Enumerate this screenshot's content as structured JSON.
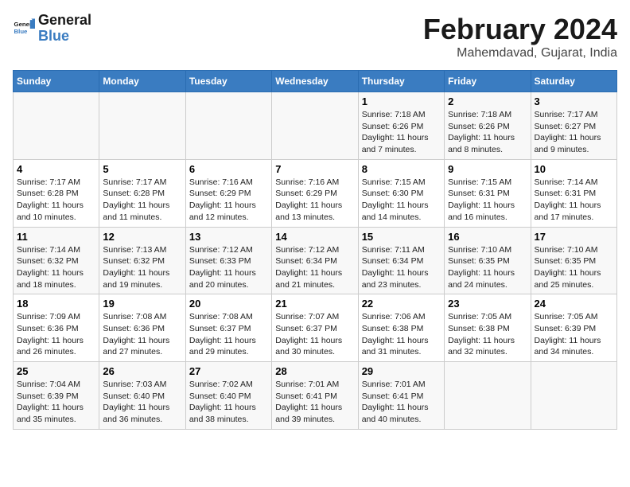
{
  "logo": {
    "line1": "General",
    "line2": "Blue"
  },
  "title": "February 2024",
  "subtitle": "Mahemdavad, Gujarat, India",
  "days_header": [
    "Sunday",
    "Monday",
    "Tuesday",
    "Wednesday",
    "Thursday",
    "Friday",
    "Saturday"
  ],
  "weeks": [
    [
      {
        "day": "",
        "info": ""
      },
      {
        "day": "",
        "info": ""
      },
      {
        "day": "",
        "info": ""
      },
      {
        "day": "",
        "info": ""
      },
      {
        "day": "1",
        "info": "Sunrise: 7:18 AM\nSunset: 6:26 PM\nDaylight: 11 hours and 7 minutes."
      },
      {
        "day": "2",
        "info": "Sunrise: 7:18 AM\nSunset: 6:26 PM\nDaylight: 11 hours and 8 minutes."
      },
      {
        "day": "3",
        "info": "Sunrise: 7:17 AM\nSunset: 6:27 PM\nDaylight: 11 hours and 9 minutes."
      }
    ],
    [
      {
        "day": "4",
        "info": "Sunrise: 7:17 AM\nSunset: 6:28 PM\nDaylight: 11 hours and 10 minutes."
      },
      {
        "day": "5",
        "info": "Sunrise: 7:17 AM\nSunset: 6:28 PM\nDaylight: 11 hours and 11 minutes."
      },
      {
        "day": "6",
        "info": "Sunrise: 7:16 AM\nSunset: 6:29 PM\nDaylight: 11 hours and 12 minutes."
      },
      {
        "day": "7",
        "info": "Sunrise: 7:16 AM\nSunset: 6:29 PM\nDaylight: 11 hours and 13 minutes."
      },
      {
        "day": "8",
        "info": "Sunrise: 7:15 AM\nSunset: 6:30 PM\nDaylight: 11 hours and 14 minutes."
      },
      {
        "day": "9",
        "info": "Sunrise: 7:15 AM\nSunset: 6:31 PM\nDaylight: 11 hours and 16 minutes."
      },
      {
        "day": "10",
        "info": "Sunrise: 7:14 AM\nSunset: 6:31 PM\nDaylight: 11 hours and 17 minutes."
      }
    ],
    [
      {
        "day": "11",
        "info": "Sunrise: 7:14 AM\nSunset: 6:32 PM\nDaylight: 11 hours and 18 minutes."
      },
      {
        "day": "12",
        "info": "Sunrise: 7:13 AM\nSunset: 6:32 PM\nDaylight: 11 hours and 19 minutes."
      },
      {
        "day": "13",
        "info": "Sunrise: 7:12 AM\nSunset: 6:33 PM\nDaylight: 11 hours and 20 minutes."
      },
      {
        "day": "14",
        "info": "Sunrise: 7:12 AM\nSunset: 6:34 PM\nDaylight: 11 hours and 21 minutes."
      },
      {
        "day": "15",
        "info": "Sunrise: 7:11 AM\nSunset: 6:34 PM\nDaylight: 11 hours and 23 minutes."
      },
      {
        "day": "16",
        "info": "Sunrise: 7:10 AM\nSunset: 6:35 PM\nDaylight: 11 hours and 24 minutes."
      },
      {
        "day": "17",
        "info": "Sunrise: 7:10 AM\nSunset: 6:35 PM\nDaylight: 11 hours and 25 minutes."
      }
    ],
    [
      {
        "day": "18",
        "info": "Sunrise: 7:09 AM\nSunset: 6:36 PM\nDaylight: 11 hours and 26 minutes."
      },
      {
        "day": "19",
        "info": "Sunrise: 7:08 AM\nSunset: 6:36 PM\nDaylight: 11 hours and 27 minutes."
      },
      {
        "day": "20",
        "info": "Sunrise: 7:08 AM\nSunset: 6:37 PM\nDaylight: 11 hours and 29 minutes."
      },
      {
        "day": "21",
        "info": "Sunrise: 7:07 AM\nSunset: 6:37 PM\nDaylight: 11 hours and 30 minutes."
      },
      {
        "day": "22",
        "info": "Sunrise: 7:06 AM\nSunset: 6:38 PM\nDaylight: 11 hours and 31 minutes."
      },
      {
        "day": "23",
        "info": "Sunrise: 7:05 AM\nSunset: 6:38 PM\nDaylight: 11 hours and 32 minutes."
      },
      {
        "day": "24",
        "info": "Sunrise: 7:05 AM\nSunset: 6:39 PM\nDaylight: 11 hours and 34 minutes."
      }
    ],
    [
      {
        "day": "25",
        "info": "Sunrise: 7:04 AM\nSunset: 6:39 PM\nDaylight: 11 hours and 35 minutes."
      },
      {
        "day": "26",
        "info": "Sunrise: 7:03 AM\nSunset: 6:40 PM\nDaylight: 11 hours and 36 minutes."
      },
      {
        "day": "27",
        "info": "Sunrise: 7:02 AM\nSunset: 6:40 PM\nDaylight: 11 hours and 38 minutes."
      },
      {
        "day": "28",
        "info": "Sunrise: 7:01 AM\nSunset: 6:41 PM\nDaylight: 11 hours and 39 minutes."
      },
      {
        "day": "29",
        "info": "Sunrise: 7:01 AM\nSunset: 6:41 PM\nDaylight: 11 hours and 40 minutes."
      },
      {
        "day": "",
        "info": ""
      },
      {
        "day": "",
        "info": ""
      }
    ]
  ]
}
